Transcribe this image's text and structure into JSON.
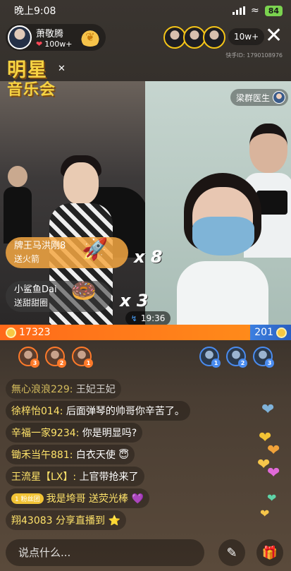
{
  "status_bar": {
    "time": "晚上9:08",
    "battery": "84"
  },
  "host": {
    "name": "萧敬腾",
    "likes": "100w+"
  },
  "viewers": {
    "count": "10w+"
  },
  "room_id": "快手ID: 1790108976",
  "show_logo": {
    "line1": "明星",
    "line2": "音乐会"
  },
  "partner": {
    "name": "梁群医生"
  },
  "gifts": [
    {
      "user": "牌王马洪刚8",
      "action": "送火箭",
      "combo": "x 8"
    },
    {
      "user": "小鲨鱼Dai",
      "action": "送甜甜圈",
      "combo": "x 3"
    }
  ],
  "timer": "19:36",
  "pk": {
    "left_score": "17323",
    "right_score": "201"
  },
  "supporters_left": [
    "3",
    "2",
    "1"
  ],
  "supporters_right": [
    "1",
    "2",
    "3"
  ],
  "chat": [
    {
      "user": "無心浪浪229: ",
      "text": "王妃王妃",
      "faded": true
    },
    {
      "user": "徐梓怡014: ",
      "text": "后面弹琴的帅哥你辛苦了。"
    },
    {
      "user": "辛福一家9234: ",
      "text": "你是明显吗?"
    },
    {
      "user": "锄禾当午881: ",
      "text": "白衣天使 😇"
    },
    {
      "user": "王流星【LX】: ",
      "text": "上官带抢来了"
    },
    {
      "badge": "1  粉丝团",
      "user": "我是垮哥",
      "text": "送荧光棒 💜"
    },
    {
      "user": "翔43083 ",
      "text": "分享直播到 ⭐"
    }
  ],
  "input": {
    "placeholder": "说点什么..."
  }
}
